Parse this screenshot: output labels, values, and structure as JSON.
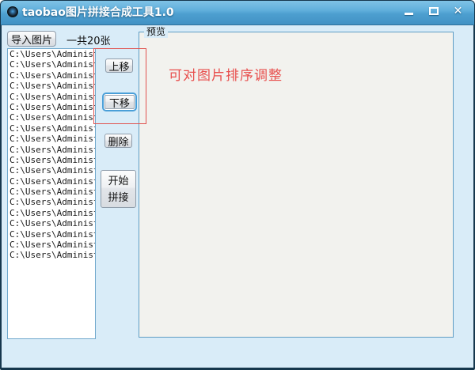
{
  "window": {
    "title": "taobao图片拼接合成工具1.0",
    "icons": {
      "app_icon": "lens-icon",
      "minimize_icon": "minimize",
      "maximize_icon": "maximize",
      "close_glyph": "✕"
    }
  },
  "toolbar": {
    "import_label": "导入图片",
    "count_label": "一共20张"
  },
  "file_list": {
    "items": [
      "C:\\Users\\Administr",
      "C:\\Users\\Administr",
      "C:\\Users\\Administr",
      "C:\\Users\\Administr",
      "C:\\Users\\Administr",
      "C:\\Users\\Administr",
      "C:\\Users\\Administr",
      "C:\\Users\\Administr",
      "C:\\Users\\Administr",
      "C:\\Users\\Administr",
      "C:\\Users\\Administr",
      "C:\\Users\\Administr",
      "C:\\Users\\Administr",
      "C:\\Users\\Administr",
      "C:\\Users\\Administr",
      "C:\\Users\\Administr",
      "C:\\Users\\Administr",
      "C:\\Users\\Administr",
      "C:\\Users\\Administr",
      "C:\\Users\\Administr"
    ]
  },
  "actions": {
    "move_up_label": "上移",
    "move_down_label": "下移",
    "delete_label": "删除",
    "start_label": "开始\n拼接"
  },
  "preview": {
    "group_label": "预览",
    "annotation": "可对图片排序调整"
  },
  "colors": {
    "titlebar_blue": "#4d9fd0",
    "content_bg": "#d9ecf8",
    "annotation_red": "#e0524f",
    "focus_blue": "#4a9fd8",
    "group_border": "#5f9dc4"
  }
}
